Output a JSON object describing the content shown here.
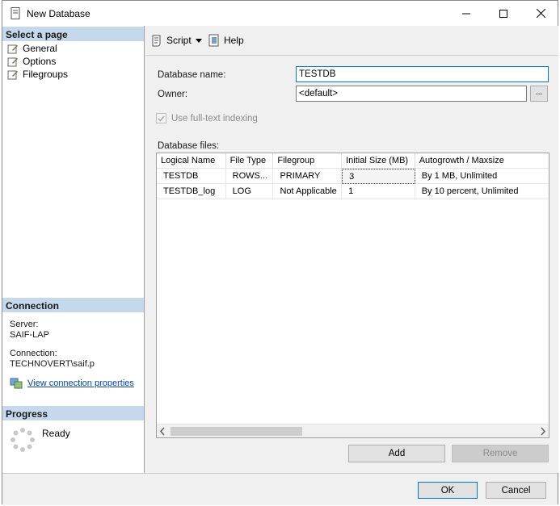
{
  "window": {
    "title": "New Database"
  },
  "left_pane": {
    "select_page_header": "Select a page",
    "pages": [
      {
        "label": "General"
      },
      {
        "label": "Options"
      },
      {
        "label": "Filegroups"
      }
    ],
    "connection_header": "Connection",
    "server_label": "Server:",
    "server_value": "SAIF-LAP",
    "connection_label": "Connection:",
    "connection_value": "TECHNOVERT\\saif.p",
    "view_connection_link": "View connection properties",
    "progress_header": "Progress",
    "progress_status": "Ready"
  },
  "toolbar": {
    "script_label": "Script",
    "help_label": "Help"
  },
  "form": {
    "database_name_label": "Database name:",
    "database_name_value": "TESTDB",
    "owner_label": "Owner:",
    "owner_value": "<default>",
    "browse_label": "...",
    "fulltext_label": "Use full-text indexing",
    "database_files_label": "Database files:"
  },
  "files_grid": {
    "columns": [
      "Logical Name",
      "File Type",
      "Filegroup",
      "Initial Size (MB)",
      "Autogrowth / Maxsize"
    ],
    "rows": [
      [
        "TESTDB",
        "ROWS...",
        "PRIMARY",
        "3",
        "By 1 MB, Unlimited"
      ],
      [
        "TESTDB_log",
        "LOG",
        "Not Applicable",
        "1",
        "By 10 percent, Unlimited"
      ]
    ]
  },
  "buttons": {
    "add": "Add",
    "remove": "Remove",
    "ok": "OK",
    "cancel": "Cancel"
  },
  "colors": {
    "section_header_bg": "#c6d9ec",
    "focus_border": "#0078d7",
    "link": "#0645ad"
  }
}
